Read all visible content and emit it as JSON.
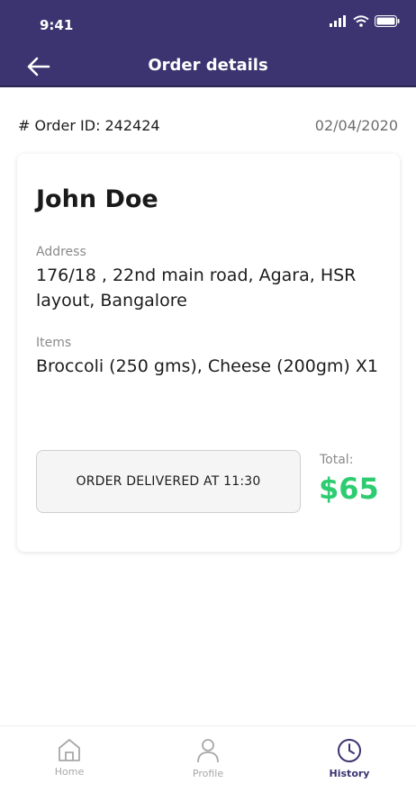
{
  "status_bar": {
    "time": "9:41",
    "icons": [
      "signal-icon",
      "wifi-icon",
      "battery-icon"
    ]
  },
  "header": {
    "title": "Order details",
    "back_icon": "arrow-left-icon",
    "background": "#3b3470"
  },
  "order": {
    "id_prefix": "# Order ID:",
    "id": "242424",
    "date": "02/04/2020"
  },
  "card": {
    "customer_name": "John Doe",
    "address_label": "Address",
    "address_value": "176/18 , 22nd main road, Agara, HSR layout, Bangalore",
    "items_label": "Items",
    "items_value": "Broccoli (250 gms), Cheese (200gm) X1",
    "status_text": "ORDER DELIVERED AT 11:30",
    "total_label": "Total:",
    "total_value": "$65",
    "total_color": "#2ecc71"
  },
  "tabs": [
    {
      "label": "Home",
      "icon": "home-icon",
      "active": false
    },
    {
      "label": "Profile",
      "icon": "profile-icon",
      "active": false
    },
    {
      "label": "History",
      "icon": "history-icon",
      "active": true
    }
  ]
}
